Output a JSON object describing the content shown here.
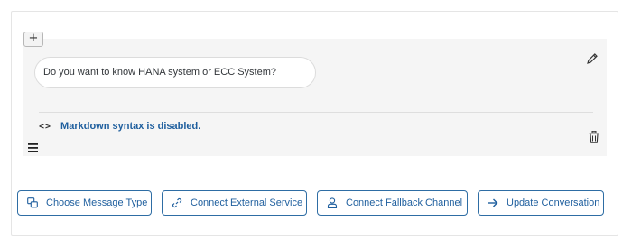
{
  "toolbar": {
    "add_label": "+"
  },
  "message": {
    "text": "Do you want to know HANA system or ECC System?",
    "markdown_notice": "Markdown syntax is disabled.",
    "code_icon_glyph": "<>"
  },
  "actions": [
    {
      "label": "Choose Message Type",
      "icon": "message-type-icon"
    },
    {
      "label": "Connect External Service",
      "icon": "link-icon"
    },
    {
      "label": "Connect Fallback Channel",
      "icon": "person-icon"
    },
    {
      "label": "Update Conversation",
      "icon": "arrow-right-icon"
    }
  ],
  "colors": {
    "accent": "#1f5f9e",
    "border": "#2e6da4",
    "panel": "#f5f5f5"
  }
}
